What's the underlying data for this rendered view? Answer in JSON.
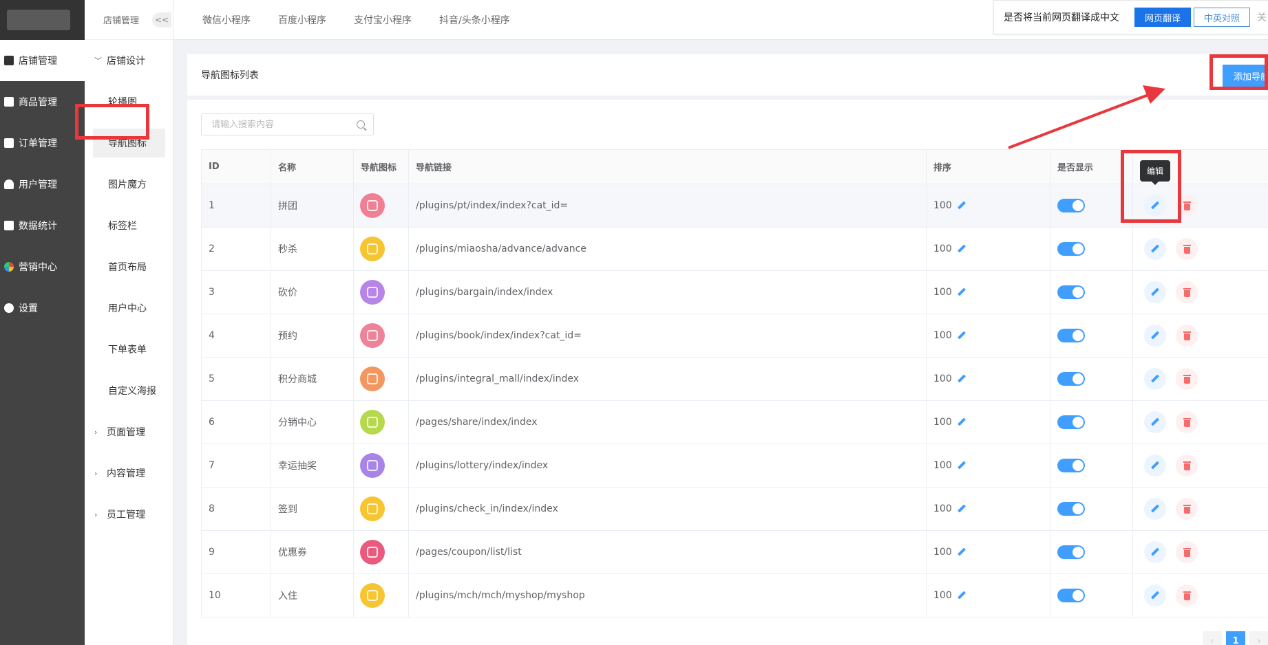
{
  "main_nav": [
    {
      "label": "店铺管理",
      "icon": "store-icon",
      "active": true
    },
    {
      "label": "商品管理",
      "icon": "goods-icon"
    },
    {
      "label": "订单管理",
      "icon": "order-icon"
    },
    {
      "label": "用户管理",
      "icon": "user-icon"
    },
    {
      "label": "数据统计",
      "icon": "chart-icon"
    },
    {
      "label": "营销中心",
      "icon": "marketing-icon"
    },
    {
      "label": "设置",
      "icon": "settings-icon"
    }
  ],
  "sub_nav": {
    "title": "店铺管理",
    "collapse_label": "<<",
    "design_group": "店铺设计",
    "design_items": [
      "轮播图",
      "导航图标",
      "图片魔方",
      "标签栏",
      "首页布局",
      "用户中心",
      "下单表单",
      "自定义海报"
    ],
    "active_item": "导航图标",
    "other_groups": [
      "页面管理",
      "内容管理",
      "员工管理"
    ]
  },
  "top_tabs": [
    "微信小程序",
    "百度小程序",
    "支付宝小程序",
    "抖音/头条小程序"
  ],
  "translate_bar": {
    "prompt": "是否将当前网页翻译成中文",
    "translate_label": "网页翻译",
    "bilingual_label": "中英对照",
    "close_label": "关"
  },
  "list_header": {
    "title": "导航图标列表",
    "add_label": "添加导航图标"
  },
  "search": {
    "placeholder": "请输入搜索内容"
  },
  "table": {
    "columns": [
      "ID",
      "名称",
      "导航图标",
      "导航链接",
      "排序",
      "是否显示",
      ""
    ],
    "rows": [
      {
        "id": "1",
        "name": "拼团",
        "link": "/plugins/pt/index/index?cat_id=",
        "sort": "100",
        "icon_color": "#f07f94",
        "show": true
      },
      {
        "id": "2",
        "name": "秒杀",
        "link": "/plugins/miaosha/advance/advance",
        "sort": "100",
        "icon_color": "#f7c531",
        "show": true
      },
      {
        "id": "3",
        "name": "砍价",
        "link": "/plugins/bargain/index/index",
        "sort": "100",
        "icon_color": "#b784e8",
        "show": true
      },
      {
        "id": "4",
        "name": "预约",
        "link": "/plugins/book/index/index?cat_id=",
        "sort": "100",
        "icon_color": "#ee8299",
        "show": true
      },
      {
        "id": "5",
        "name": "积分商城",
        "link": "/plugins/integral_mall/index/index",
        "sort": "100",
        "icon_color": "#f39660",
        "show": true
      },
      {
        "id": "6",
        "name": "分销中心",
        "link": "/pages/share/index/index",
        "sort": "100",
        "icon_color": "#b5d94a",
        "show": true
      },
      {
        "id": "7",
        "name": "幸运抽奖",
        "link": "/plugins/lottery/index/index",
        "sort": "100",
        "icon_color": "#a883e8",
        "show": true
      },
      {
        "id": "8",
        "name": "签到",
        "link": "/plugins/check_in/index/index",
        "sort": "100",
        "icon_color": "#f7c531",
        "show": true
      },
      {
        "id": "9",
        "name": "优惠券",
        "link": "/pages/coupon/list/list",
        "sort": "100",
        "icon_color": "#e85a7e",
        "show": true
      },
      {
        "id": "10",
        "name": "入住",
        "link": "/plugins/mch/mch/myshop/myshop",
        "sort": "100",
        "icon_color": "#f7c531",
        "show": true
      }
    ]
  },
  "tooltip": "编辑",
  "pager": {
    "prev": "‹",
    "current": "1",
    "next": "›"
  },
  "colors": {
    "primary": "#409eff",
    "annotation_red": "#e8383d",
    "sidebar": "#434343"
  }
}
